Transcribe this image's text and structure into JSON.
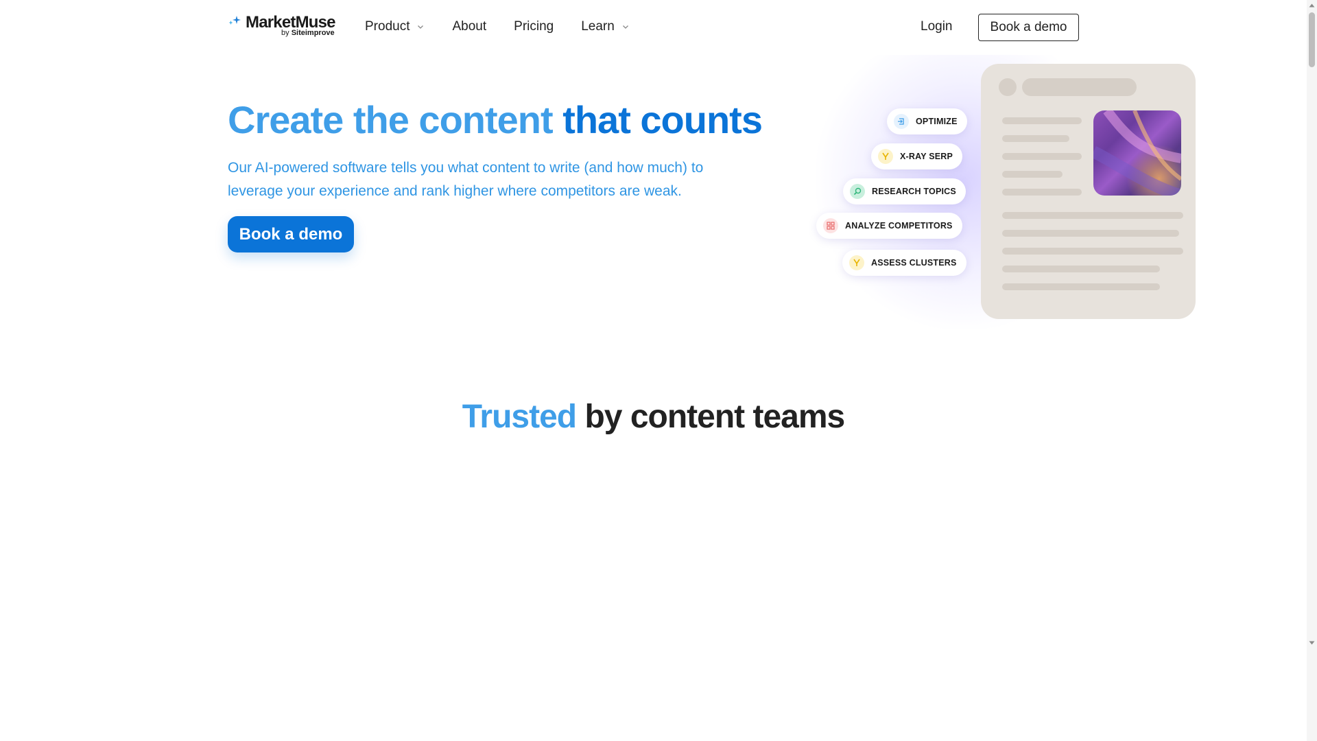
{
  "header": {
    "logo": {
      "name": "MarketMuse",
      "byline_prefix": "by",
      "byline_brand": "Siteimprove"
    },
    "nav": [
      {
        "label": "Product",
        "has_dropdown": true
      },
      {
        "label": "About",
        "has_dropdown": false
      },
      {
        "label": "Pricing",
        "has_dropdown": false
      },
      {
        "label": "Learn",
        "has_dropdown": true
      }
    ],
    "login_label": "Login",
    "demo_label": "Book a demo"
  },
  "hero": {
    "title_light": "Create the content",
    "title_dark": "that counts",
    "subtitle": "Our AI-powered software tells you what content to write (and how much) to leverage your experience and rank higher where competitors are weak.",
    "cta_label": "Book a demo"
  },
  "features": [
    {
      "label": "OPTIMIZE",
      "icon": "optimize-icon",
      "color": "#3f9ee8"
    },
    {
      "label": "X-RAY SERP",
      "icon": "xray-serp-icon",
      "color": "#e8b400"
    },
    {
      "label": "RESEARCH TOPICS",
      "icon": "research-topics-icon",
      "color": "#2fb67a"
    },
    {
      "label": "ANALYZE COMPETITORS",
      "icon": "analyze-competitors-icon",
      "color": "#e86a6a"
    },
    {
      "label": "ASSESS CLUSTERS",
      "icon": "assess-clusters-icon",
      "color": "#e8b400"
    }
  ],
  "trusted": {
    "light": "Trusted",
    "dark": "by content teams"
  },
  "colors": {
    "brand_blue": "#0b74d8",
    "light_blue": "#3f9ee8",
    "doc_card_bg": "#e7e2dc"
  }
}
